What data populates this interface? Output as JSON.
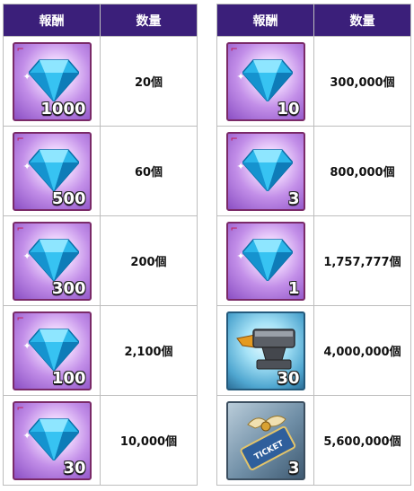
{
  "headers": {
    "reward": "報酬",
    "quantity": "数量"
  },
  "left": [
    {
      "item_count": "1000",
      "quantity": "20個",
      "icon": "blue-crystal-icon"
    },
    {
      "item_count": "500",
      "quantity": "60個",
      "icon": "blue-crystal-icon"
    },
    {
      "item_count": "300",
      "quantity": "200個",
      "icon": "blue-crystal-icon"
    },
    {
      "item_count": "100",
      "quantity": "2,100個",
      "icon": "blue-crystal-icon"
    },
    {
      "item_count": "30",
      "quantity": "10,000個",
      "icon": "blue-crystal-icon"
    }
  ],
  "right": [
    {
      "item_count": "10",
      "quantity": "300,000個",
      "icon": "blue-crystal-icon"
    },
    {
      "item_count": "3",
      "quantity": "800,000個",
      "icon": "blue-crystal-icon"
    },
    {
      "item_count": "1",
      "quantity": "1,757,777個",
      "icon": "blue-crystal-icon"
    },
    {
      "item_count": "30",
      "quantity": "4,000,000個",
      "icon": "anvil-icon"
    },
    {
      "item_count": "3",
      "quantity": "5,600,000個",
      "icon": "winged-ticket-icon",
      "ticket_text": "TICKET"
    }
  ]
}
